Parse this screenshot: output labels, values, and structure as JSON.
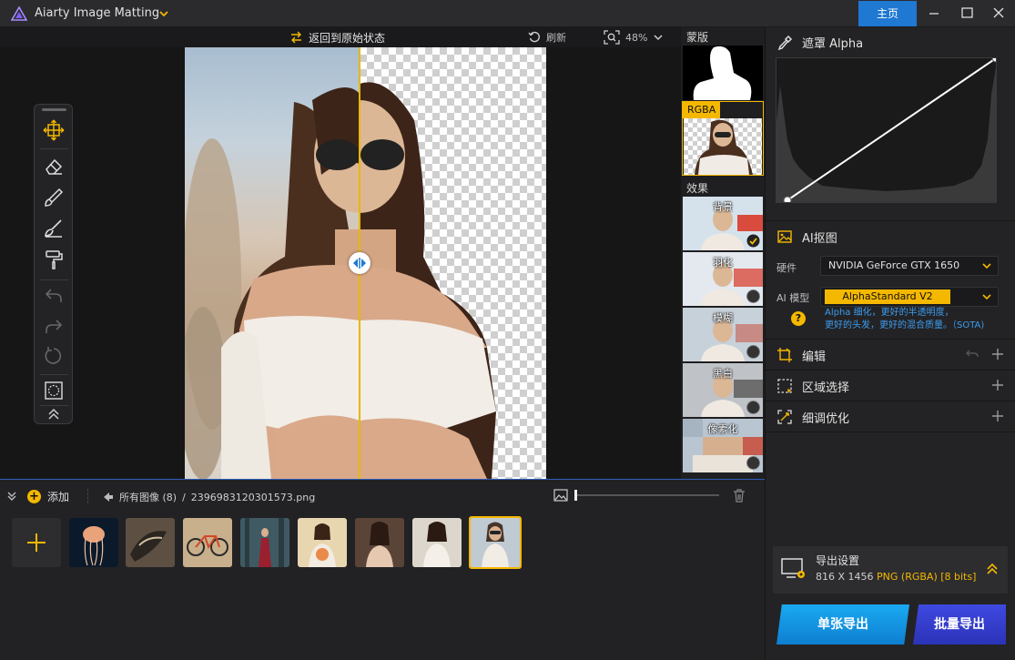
{
  "window": {
    "title": "Aiarty Image Matting",
    "home_label": "主页"
  },
  "canvas_toolbar": {
    "revert_label": "返回到原始状态",
    "refresh_label": "刷新",
    "zoom_value": "48%"
  },
  "side_column": {
    "mask_label": "蒙版",
    "rgba_label": "RGBA",
    "effects_label": "效果",
    "effects": [
      {
        "label": "背景",
        "selected": true
      },
      {
        "label": "羽化",
        "selected": false
      },
      {
        "label": "模糊",
        "selected": false
      },
      {
        "label": "黑白",
        "selected": false
      },
      {
        "label": "像素化",
        "selected": false
      }
    ]
  },
  "right_panel": {
    "alpha_title": "遮罩 Alpha",
    "ai_title": "AI抠图",
    "hardware_label": "硬件",
    "hardware_value": "NVIDIA GeForce GTX 1650",
    "model_label": "AI 模型",
    "model_value": "AlphaStandard  V2",
    "model_desc_line1": "Alpha 细化，更好的半透明度，",
    "model_desc_line2": "更好的头发，更好的混合质量。（SOTA)",
    "sections": [
      {
        "title": "编辑"
      },
      {
        "title": "区域选择"
      },
      {
        "title": "细调优化"
      }
    ],
    "export": {
      "title": "导出设置",
      "size": "816 X 1456",
      "format": "PNG (RGBA) [8 bits]"
    },
    "export_single_label": "单张导出",
    "export_batch_label": "批量导出"
  },
  "strip": {
    "add_label": "添加",
    "all_images_label": "所有图像 (8)",
    "separator": "/",
    "current_file": "2396983120301573.png"
  },
  "colors": {
    "accent": "#f5b800",
    "primary_blue": "#1f78d1",
    "link_blue": "#3d9cf0"
  }
}
